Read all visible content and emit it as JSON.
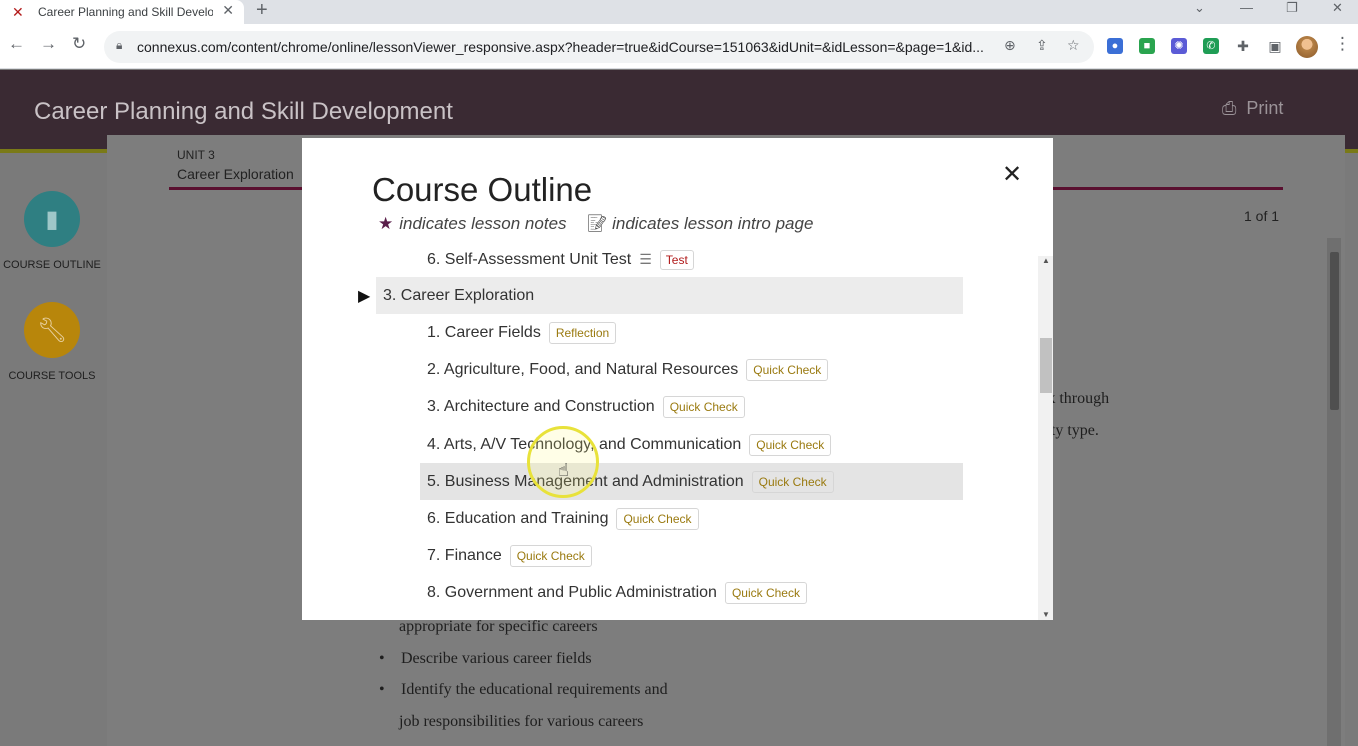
{
  "browser": {
    "tab_title": "Career Planning and Skill Develo",
    "url": "connexus.com/content/chrome/online/lessonViewer_responsive.aspx?header=true&idCourse=151063&idUnit=&idLesson=&page=1&id..."
  },
  "header": {
    "title": "Career Planning and Skill Development",
    "print_label": "Print"
  },
  "sidebar": {
    "items": [
      {
        "label": "COURSE OUTLINE",
        "icon": "book-icon",
        "color": "#2f7f82"
      },
      {
        "label": "COURSE TOOLS",
        "icon": "wrench-icon",
        "color": "#b8860b"
      }
    ]
  },
  "content": {
    "unit_label": "UNIT 3",
    "unit_title": "Career Exploration",
    "pager": "1 of 1",
    "text_right_1": "rk through",
    "text_right_2": "lity type.",
    "text_bottom_1": "appropriate for specific careers",
    "bullet_1": "Describe various career fields",
    "bullet_2": "Identify the educational requirements and",
    "text_bottom_2": "job responsibilities for various careers"
  },
  "modal": {
    "title": "Course Outline",
    "legend_notes": "indicates lesson notes",
    "legend_intro": "indicates lesson intro page",
    "prev_lesson": {
      "label": "6. Self-Assessment Unit Test",
      "badge": "Test"
    },
    "unit": {
      "label": "3. Career Exploration"
    },
    "lessons": [
      {
        "label": "1. Career Fields",
        "badge": "Reflection"
      },
      {
        "label": "2. Agriculture, Food, and Natural Resources",
        "badge": "Quick Check"
      },
      {
        "label": "3. Architecture and Construction",
        "badge": "Quick Check"
      },
      {
        "label": "4. Arts, A/V Technology, and Communication",
        "badge": "Quick Check"
      },
      {
        "label": "5. Business Management and Administration",
        "badge": "Quick Check"
      },
      {
        "label": "6. Education and Training",
        "badge": "Quick Check"
      },
      {
        "label": "7. Finance",
        "badge": "Quick Check"
      },
      {
        "label": "8. Government and Public Administration",
        "badge": "Quick Check"
      }
    ]
  }
}
